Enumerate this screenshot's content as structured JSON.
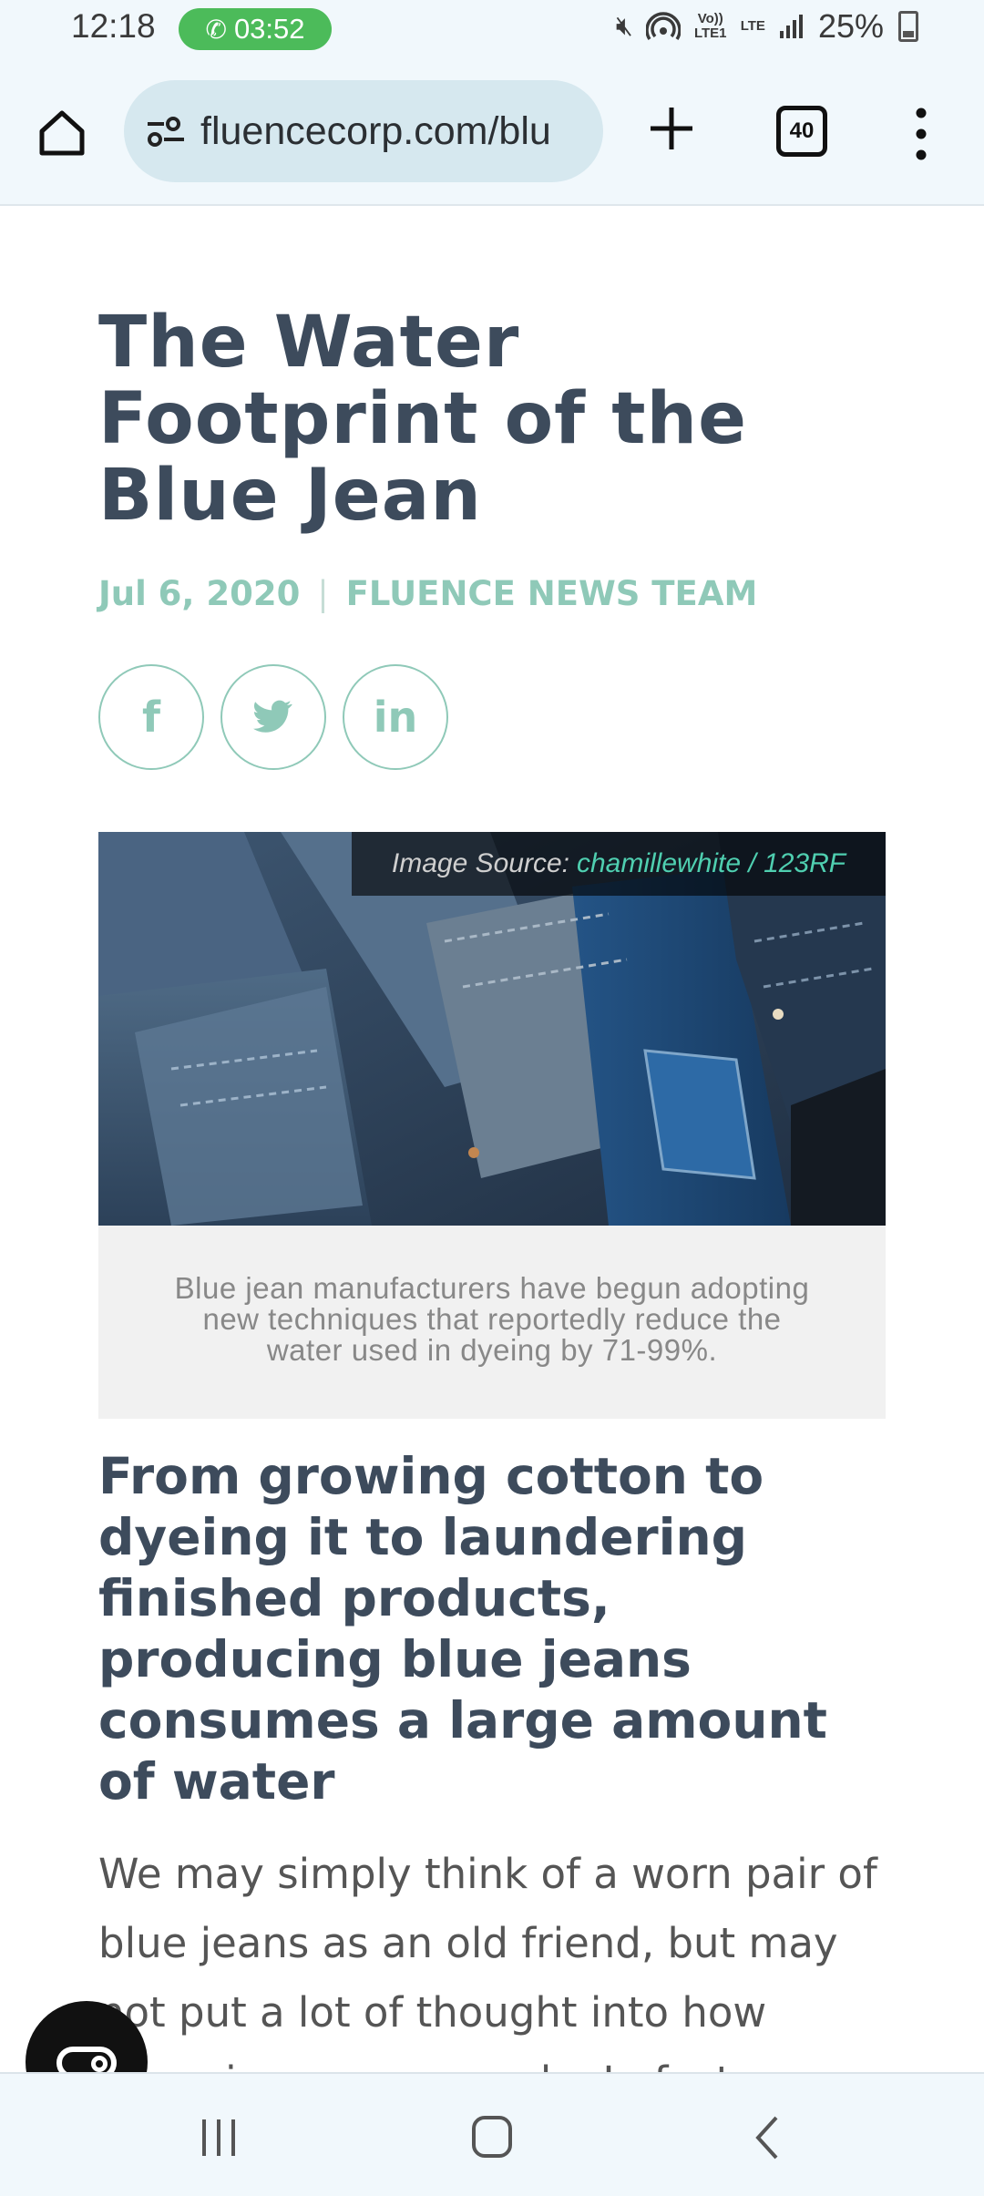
{
  "status_bar": {
    "time": "12:18",
    "call_timer": "03:52",
    "network_volte": "Vo)) LTE1",
    "network_lte": "LTE",
    "battery": "25%",
    "icons": [
      "phone-icon",
      "mute-icon",
      "hotspot-icon",
      "signal-icon",
      "battery-icon"
    ]
  },
  "browser": {
    "url": "fluencecorp.com/blu",
    "tab_count": "40",
    "icons": [
      "home-icon",
      "site-settings-icon",
      "new-tab-icon",
      "tabs-icon",
      "menu-icon"
    ]
  },
  "article": {
    "title": "The Water Footprint of the Blue Jean",
    "date": "Jul 6, 2020",
    "separator": "|",
    "author": "FLUENCE NEWS TEAM",
    "social": [
      {
        "icon": "facebook-icon",
        "glyph": "f"
      },
      {
        "icon": "twitter-icon",
        "glyph": "🐦"
      },
      {
        "icon": "linkedin-icon",
        "glyph": "in"
      }
    ],
    "image_credit_label": "Image Source:",
    "image_credit_link": "chamillewhite / 123RF",
    "caption": "Blue jean manufacturers have begun adopting new techniques that reportedly reduce the water used in dyeing by 71-99%.",
    "subheading": "From growing cotton to dyeing it to laundering finished products, producing blue jeans consumes a large amount of water",
    "body": "We may simply think of a worn pair of blue jeans as an old friend, but may not put a lot of thought into how those jeans were made. In fact, a great"
  },
  "colors": {
    "title": "#3d4b5c",
    "accent": "#8fc9b8",
    "credit_link": "#4fcfb0",
    "call_badge": "#4cbb5a"
  }
}
